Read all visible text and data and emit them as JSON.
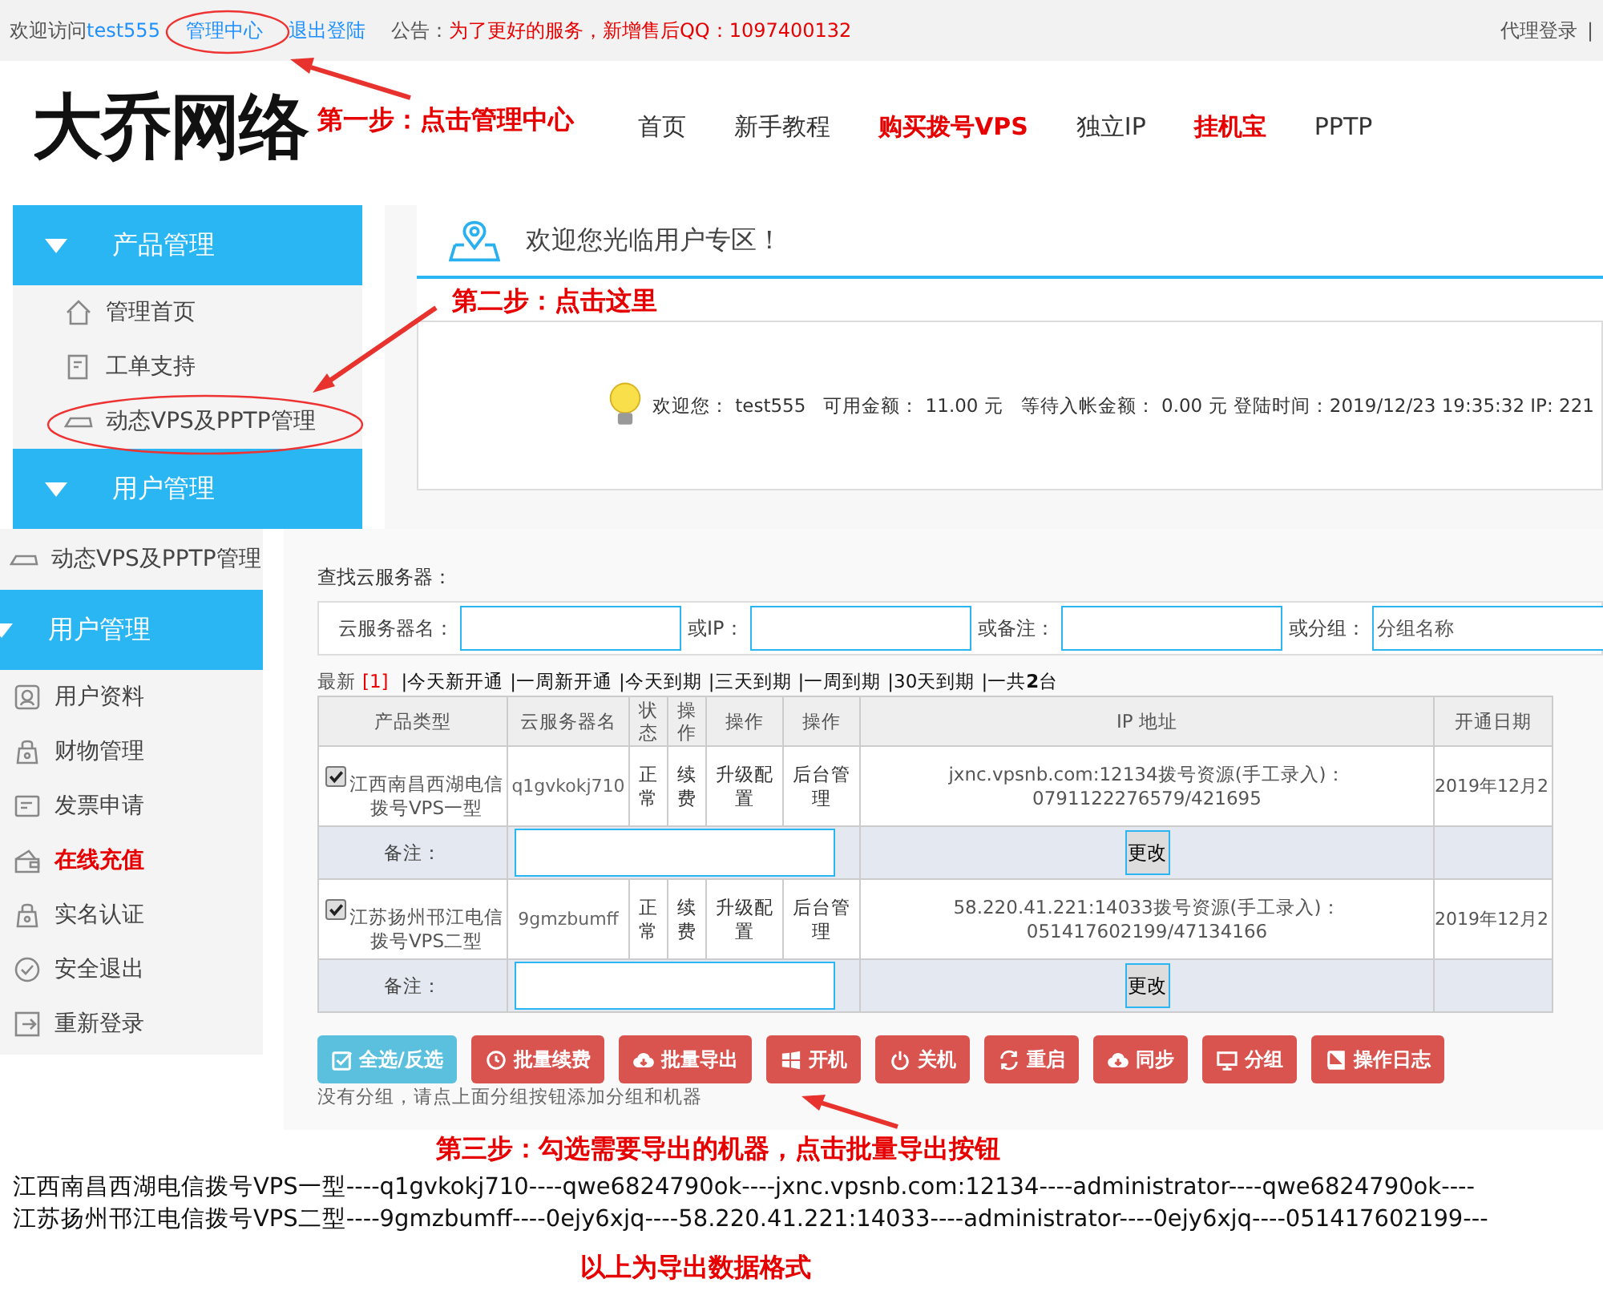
{
  "top_bar": {
    "greeting": "欢迎访问",
    "username": "test555",
    "links": [
      "管理中心",
      "退出登陆"
    ],
    "notice_label": "公告：",
    "notice": "为了更好的服务，新增售后QQ：1097400132",
    "agent_login": "代理登录",
    "separator": "|"
  },
  "header": {
    "logo": "大乔网络",
    "nav": [
      {
        "label": "首页",
        "highlighted": false
      },
      {
        "label": "新手教程",
        "highlighted": false
      },
      {
        "label": "购买拨号VPS",
        "highlighted": true
      },
      {
        "label": "独立IP",
        "highlighted": false
      },
      {
        "label": "挂机宝",
        "highlighted": true
      },
      {
        "label": "PPTP",
        "highlighted": false
      }
    ]
  },
  "annotations": {
    "step1": "第一步：点击管理中心",
    "step2": "第二步：点击这里",
    "step3": "第三步：勾选需要导出的机器，点击批量导出按钮",
    "caption": "以上为导出数据格式"
  },
  "panel_one": {
    "sidebar": [
      {
        "title": "产品管理",
        "expanded": true,
        "items": [
          {
            "label": "管理首页",
            "highlighted": false
          },
          {
            "label": "工单支持",
            "highlighted": false
          },
          {
            "label": "动态VPS及PPTP管理",
            "highlighted": false
          }
        ]
      },
      {
        "title": "用户管理",
        "expanded": true
      }
    ],
    "welcome_title": "欢迎您光临用户专区！",
    "welcome_info": "欢迎您： test555   可用金额： 11.00 元   等待入帐金额： 0.00 元 登陆时间：2019/12/23 19:35:32 IP: 221"
  },
  "panel_two": {
    "sidebar_top_item": "动态VPS及PPTP管理",
    "sidebar": [
      {
        "title": "用户管理",
        "expanded": true,
        "items": [
          {
            "label": "用户资料",
            "highlighted": false
          },
          {
            "label": "财物管理",
            "highlighted": false
          },
          {
            "label": "发票申请",
            "highlighted": false
          },
          {
            "label": "在线充值",
            "highlighted": true
          },
          {
            "label": "实名认证",
            "highlighted": false
          },
          {
            "label": "安全退出",
            "highlighted": false
          },
          {
            "label": "重新登录",
            "highlighted": false
          }
        ]
      }
    ],
    "search": {
      "title": "查找云服务器：",
      "fields": [
        {
          "label": "云服务器名："
        },
        {
          "label": "或IP："
        },
        {
          "label": "或备注："
        },
        {
          "label": "或分组：",
          "placeholder": "分组名称"
        }
      ]
    },
    "filters": {
      "first": "最新",
      "first_count": "[1]",
      "links": [
        "|今天新开通",
        "|一周新开通",
        "|今天到期",
        "|三天到期",
        "|一周到期",
        "|30天到期",
        "|一共**2**台"
      ]
    },
    "table": {
      "columns": [
        "产品类型",
        "云服务器名",
        "状态",
        "操作",
        "操作",
        "操作",
        "IP 地址",
        "开通日期"
      ],
      "rows": [
        {
          "checked": true,
          "product": "江西南昌西湖电信拨号VPS一型",
          "name": "q1gvkokj710",
          "status": "正常",
          "renew": "续费",
          "upgrade": "升级配置",
          "admin": "后台管理",
          "ip": "jxnc.vpsnb.com:12134拨号资源(手工录入)：0791122276579/421695",
          "date": "2019年12月2",
          "remark_label": "备注：",
          "remark_button": "更改"
        },
        {
          "checked": true,
          "product": "江苏扬州邗江电信拨号VPS二型",
          "name": "9gmzbumff",
          "status": "正常",
          "renew": "续费",
          "upgrade": "升级配置",
          "admin": "后台管理",
          "ip": "58.220.41.221:14033拨号资源(手工录入)：051417602199/47134166",
          "date": "2019年12月2",
          "remark_label": "备注：",
          "remark_button": "更改"
        }
      ]
    },
    "buttons": [
      {
        "label": "全选/反选",
        "kind": "info"
      },
      {
        "label": "批量续费",
        "kind": "danger"
      },
      {
        "label": "批量导出",
        "kind": "danger"
      },
      {
        "label": "开机",
        "kind": "danger"
      },
      {
        "label": "关机",
        "kind": "danger"
      },
      {
        "label": "重启",
        "kind": "danger"
      },
      {
        "label": "同步",
        "kind": "danger"
      },
      {
        "label": "分组",
        "kind": "danger"
      },
      {
        "label": "操作日志",
        "kind": "danger"
      }
    ],
    "note": "没有分组，请点上面分组按钮添加分组和机器"
  },
  "export_lines": [
    "江西南昌西湖电信拨号VPS一型----q1gvkokj710----qwe6824790ok----jxnc.vpsnb.com:12134----administrator----qwe6824790ok----",
    "江苏扬州邗江电信拨号VPS二型----9gmzbumff----0ejy6xjq----58.220.41.221:14033----administrator----0ejy6xjq----051417602199---"
  ]
}
